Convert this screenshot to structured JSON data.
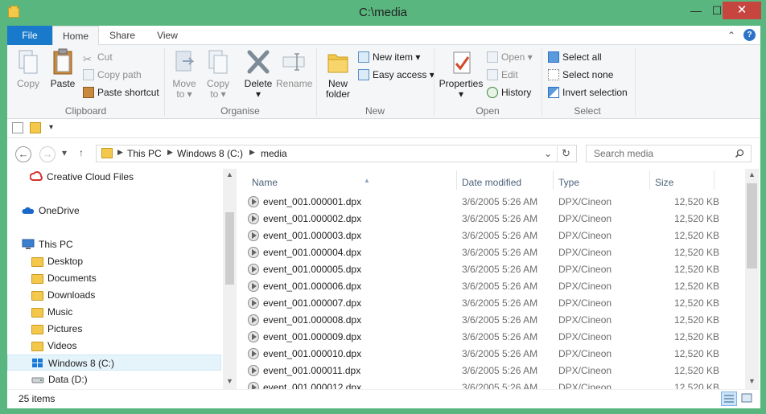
{
  "window": {
    "title": "C:\\media",
    "minimize": "—",
    "maximize": "☐",
    "close": "✕"
  },
  "ribbon_tabs": [
    {
      "label": "File"
    },
    {
      "label": "Home"
    },
    {
      "label": "Share"
    },
    {
      "label": "View"
    }
  ],
  "ribbon": {
    "clipboard": {
      "group_label": "Clipboard",
      "copy": "Copy",
      "paste": "Paste",
      "cut": "Cut",
      "copy_path": "Copy path",
      "paste_shortcut": "Paste shortcut"
    },
    "organise": {
      "group_label": "Organise",
      "move_to": "Move",
      "move_to_2": "to",
      "copy_to": "Copy",
      "copy_to_2": "to",
      "delete": "Delete",
      "rename": "Rename"
    },
    "new": {
      "group_label": "New",
      "new_folder": "New",
      "new_folder_2": "folder",
      "new_item": "New item",
      "easy_access": "Easy access"
    },
    "open": {
      "group_label": "Open",
      "properties": "Properties",
      "open": "Open",
      "edit": "Edit",
      "history": "History"
    },
    "select": {
      "group_label": "Select",
      "select_all": "Select all",
      "select_none": "Select none",
      "invert_selection": "Invert selection"
    }
  },
  "address_bar": {
    "crumbs": [
      "This PC",
      "Windows 8 (C:)",
      "media"
    ],
    "search_placeholder": "Search media"
  },
  "nav_pane": {
    "items": [
      {
        "label": "Creative Cloud Files",
        "icon": "creative-cloud-icon"
      },
      {
        "label": "OneDrive",
        "icon": "onedrive-icon"
      },
      {
        "label": "This PC",
        "icon": "computer-icon"
      },
      {
        "label": "Desktop",
        "icon": "folder-icon"
      },
      {
        "label": "Documents",
        "icon": "folder-icon"
      },
      {
        "label": "Downloads",
        "icon": "folder-icon"
      },
      {
        "label": "Music",
        "icon": "folder-icon"
      },
      {
        "label": "Pictures",
        "icon": "folder-icon"
      },
      {
        "label": "Videos",
        "icon": "folder-icon"
      },
      {
        "label": "Windows 8 (C:)",
        "icon": "windows-drive-icon"
      },
      {
        "label": "Data (D:)",
        "icon": "drive-icon"
      }
    ]
  },
  "file_list": {
    "columns": {
      "name": "Name",
      "date": "Date modified",
      "type": "Type",
      "size": "Size"
    },
    "rows": [
      {
        "name": "event_001.000001.dpx",
        "date": "3/6/2005 5:26 AM",
        "type": "DPX/Cineon",
        "size": "12,520 KB"
      },
      {
        "name": "event_001.000002.dpx",
        "date": "3/6/2005 5:26 AM",
        "type": "DPX/Cineon",
        "size": "12,520 KB"
      },
      {
        "name": "event_001.000003.dpx",
        "date": "3/6/2005 5:26 AM",
        "type": "DPX/Cineon",
        "size": "12,520 KB"
      },
      {
        "name": "event_001.000004.dpx",
        "date": "3/6/2005 5:26 AM",
        "type": "DPX/Cineon",
        "size": "12,520 KB"
      },
      {
        "name": "event_001.000005.dpx",
        "date": "3/6/2005 5:26 AM",
        "type": "DPX/Cineon",
        "size": "12,520 KB"
      },
      {
        "name": "event_001.000006.dpx",
        "date": "3/6/2005 5:26 AM",
        "type": "DPX/Cineon",
        "size": "12,520 KB"
      },
      {
        "name": "event_001.000007.dpx",
        "date": "3/6/2005 5:26 AM",
        "type": "DPX/Cineon",
        "size": "12,520 KB"
      },
      {
        "name": "event_001.000008.dpx",
        "date": "3/6/2005 5:26 AM",
        "type": "DPX/Cineon",
        "size": "12,520 KB"
      },
      {
        "name": "event_001.000009.dpx",
        "date": "3/6/2005 5:26 AM",
        "type": "DPX/Cineon",
        "size": "12,520 KB"
      },
      {
        "name": "event_001.000010.dpx",
        "date": "3/6/2005 5:26 AM",
        "type": "DPX/Cineon",
        "size": "12,520 KB"
      },
      {
        "name": "event_001.000011.dpx",
        "date": "3/6/2005 5:26 AM",
        "type": "DPX/Cineon",
        "size": "12,520 KB"
      },
      {
        "name": "event_001.000012.dpx",
        "date": "3/6/2005 5:26 AM",
        "type": "DPX/Cineon",
        "size": "12,520 KB"
      }
    ]
  },
  "status": {
    "item_count": "25 items"
  },
  "colors": {
    "window_frame": "#5ab67f",
    "file_tab": "#1979ca",
    "close_button": "#c7453f"
  }
}
